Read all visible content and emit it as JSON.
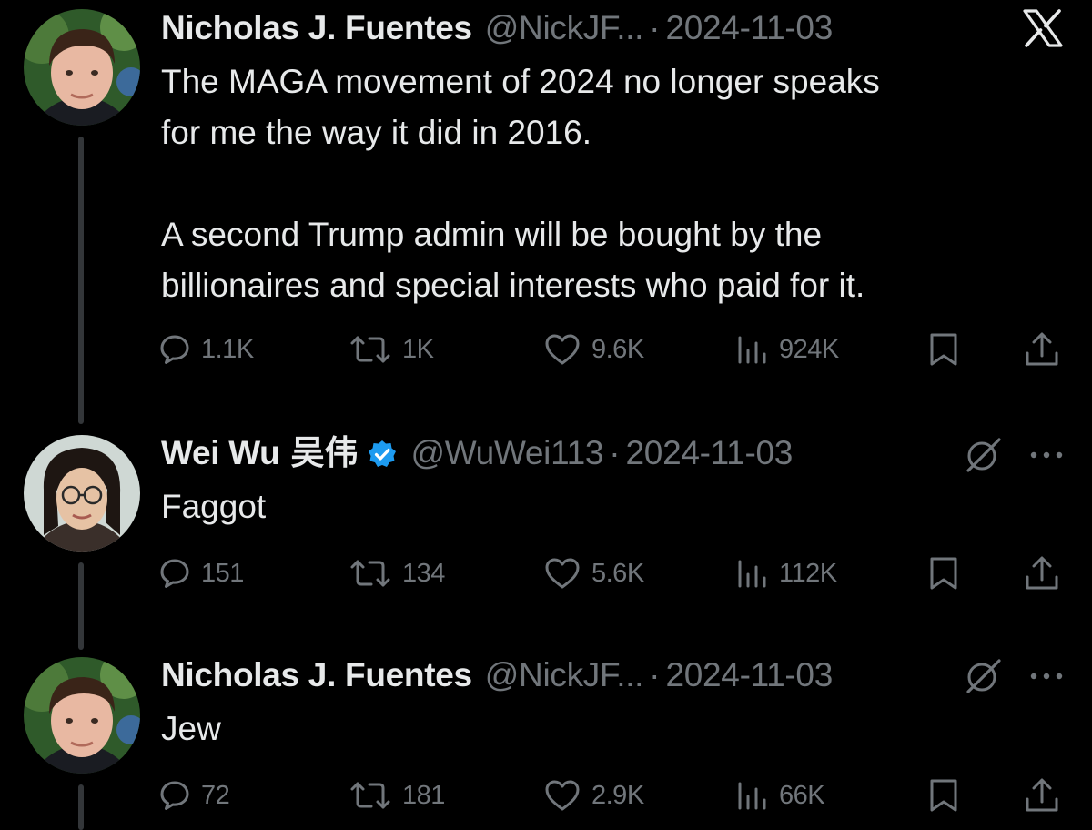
{
  "brand": {
    "logo_icon": "x-logo-icon"
  },
  "colors": {
    "background": "#000000",
    "primary_text": "#e7e9ea",
    "secondary_text": "#71767b",
    "thread_line": "#333639",
    "verified_badge": "#1d9bf0"
  },
  "tweets": [
    {
      "display_name": "Nicholas J. Fuentes",
      "handle": "@NickJF...",
      "separator": "·",
      "date": "2024-11-03",
      "text": "The MAGA movement of 2024 no longer speaks\nfor me the way it did in 2016.\n\nA second Trump admin will be bought by the\nbillionaires and special interests who paid for it.",
      "replies": "1.1K",
      "reposts": "1K",
      "likes": "9.6K",
      "views": "924K"
    },
    {
      "display_name": "Wei Wu",
      "display_name_cjk": "吴伟",
      "verified": true,
      "handle": "@WuWei113",
      "separator": "·",
      "date": "2024-11-03",
      "text": "Faggot",
      "replies": "151",
      "reposts": "134",
      "likes": "5.6K",
      "views": "112K"
    },
    {
      "display_name": "Nicholas J. Fuentes",
      "handle": "@NickJF...",
      "separator": "·",
      "date": "2024-11-03",
      "text": "Jew",
      "replies": "72",
      "reposts": "181",
      "likes": "2.9K",
      "views": "66K"
    }
  ],
  "icons": {
    "reply": "reply-icon",
    "repost": "repost-icon",
    "like": "heart-icon",
    "views": "views-chart-icon",
    "bookmark": "bookmark-icon",
    "share": "share-icon",
    "grok": "grok-icon",
    "more": "more-icon"
  }
}
